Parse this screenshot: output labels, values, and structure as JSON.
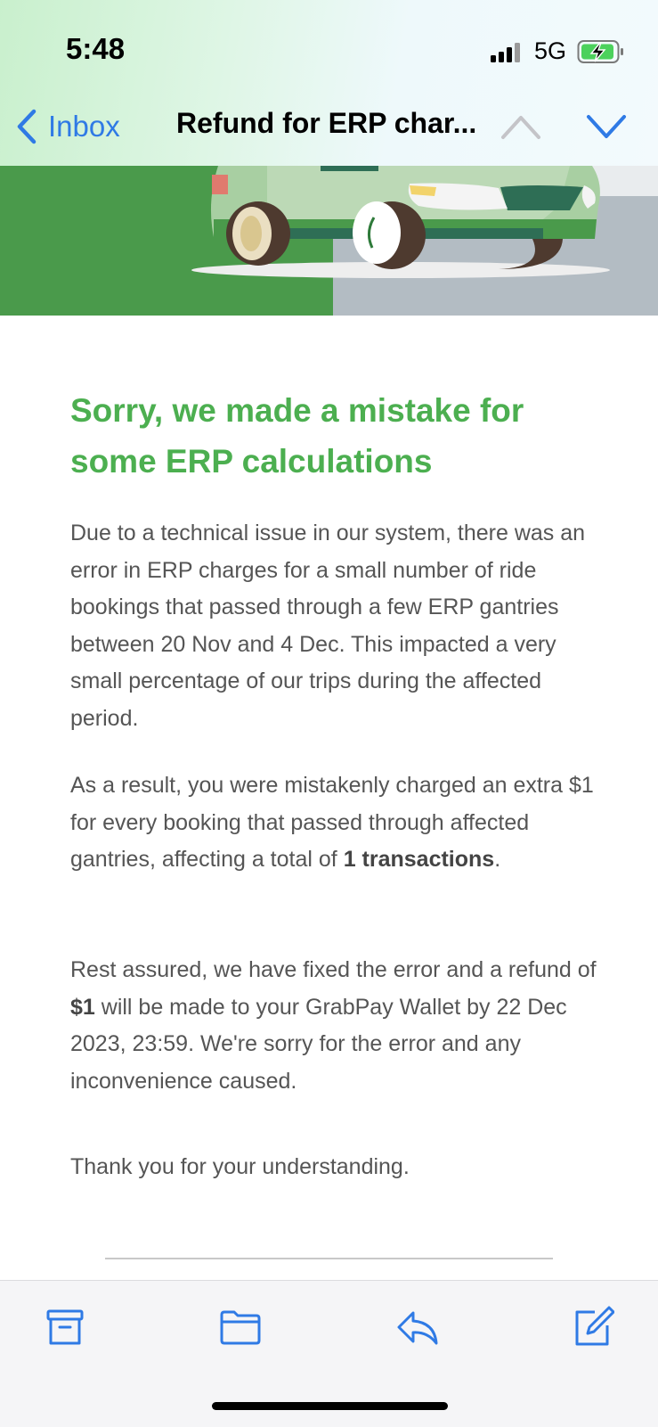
{
  "status_bar": {
    "time": "5:48",
    "network": "5G"
  },
  "nav": {
    "back_label": "Inbox",
    "subject": "Refund for ERP char..."
  },
  "email": {
    "headline": "Sorry, we made a mistake for some ERP calculations",
    "para1": "Due to a technical issue in our system, there was an error in ERP charges for a small number of ride bookings that passed through a few ERP gantries between 20 Nov and 4 Dec. This impacted a very small percentage of our trips during the affected period.",
    "para2": {
      "before": "As a result, you were mistakenly charged an extra $1 for every booking that passed through affected gantries, affecting a total of ",
      "bold": "1 transactions",
      "after": "."
    },
    "para3": {
      "before": "Rest assured, we have fixed the error and a refund of ",
      "bold": "$1",
      "after": " will be made to your GrabPay Wallet by 22 Dec 2023, 23:59. We're sorry for the error and any inconvenience caused."
    },
    "para4": "Thank you for your understanding."
  },
  "toolbar": {
    "icons": [
      "archive-icon",
      "folder-icon",
      "reply-icon",
      "compose-icon"
    ]
  },
  "colors": {
    "headline": "#4caf50",
    "accent": "#2f7ae5",
    "body_text": "#555555"
  }
}
